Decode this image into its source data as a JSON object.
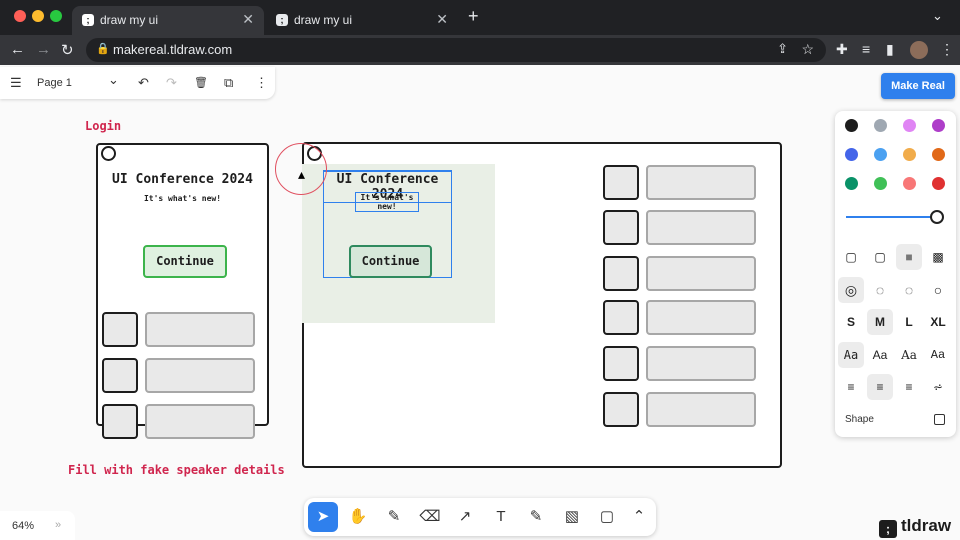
{
  "browser": {
    "tabs": [
      {
        "title": "draw my ui",
        "close": "✕"
      },
      {
        "title": "draw my ui",
        "close": "✕"
      }
    ],
    "new_tab": "+",
    "url": "makereal.tldraw.com",
    "favicon_glyph": ";",
    "nav": {
      "back": "←",
      "forward": "→",
      "reload": "↻"
    },
    "right_icons": {
      "share": "⇪",
      "star": "☆",
      "extensions": "✚",
      "reading": "≡",
      "sidebar": "▮",
      "menu": "⋮"
    },
    "menu_glyph": "⌄"
  },
  "menu_panel": {
    "hamburger": "☰",
    "page": "Page 1",
    "chevron": "⌄",
    "undo": "↶",
    "redo": "↷",
    "delete": "🗑",
    "duplicate": "⧉",
    "more": "⋮"
  },
  "make_real": "Make Real",
  "annotations": {
    "login": "Login",
    "fill": "Fill with fake speaker details"
  },
  "sketch_left": {
    "title": "UI Conference 2024",
    "subtitle": "It's what's new!",
    "button": "Continue"
  },
  "sketch_right": {
    "title": "UI Conference 2024",
    "subtitle": "It's what's new!",
    "button": "Continue"
  },
  "style_panel": {
    "colors": [
      "#1d1d1d",
      "#9fa8b2",
      "#e085f4",
      "#ae3ec9",
      "#4465e9",
      "#4ba1f1",
      "#f1ac4b",
      "#e16919",
      "#099268",
      "#40c057",
      "#f87777",
      "#e03131"
    ],
    "opacity": 1.0,
    "fills": [
      "▢",
      "▢",
      "■",
      "▩"
    ],
    "dashes": [
      "◎",
      "◌",
      "◌",
      "○"
    ],
    "sizes": [
      "S",
      "M",
      "L",
      "XL"
    ],
    "fonts": [
      "Aa",
      "Aa",
      "Aa",
      "Aa"
    ],
    "aligns": [
      "≡",
      "≡",
      "≡",
      "⩫"
    ],
    "shape_label": "Shape"
  },
  "zoom": {
    "value": "64%",
    "chevron": "»"
  },
  "tools": [
    "➤",
    "✋",
    "✎",
    "⌫",
    "↗",
    "T",
    "✎",
    "▧",
    "▢",
    "⌃"
  ],
  "brand": {
    "mark": ";",
    "name": "tldraw"
  }
}
